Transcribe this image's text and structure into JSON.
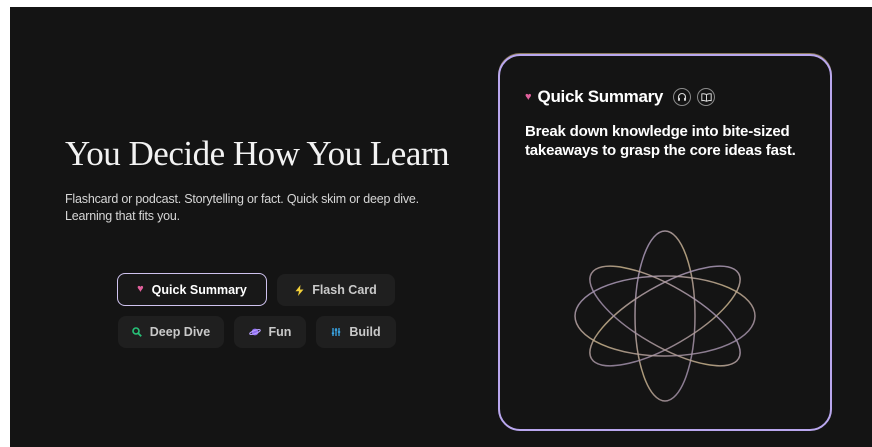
{
  "hero": {
    "title": "You Decide How You Learn",
    "subtitle": "Flashcard or podcast. Storytelling or fact. Quick skim or deep dive. Learning that fits you."
  },
  "modes": [
    {
      "label": "Quick Summary",
      "icon": "heart-icon",
      "color": "#e0609c",
      "active": true
    },
    {
      "label": "Flash Card",
      "icon": "lightning-icon",
      "color": "#f2d03a",
      "active": false
    },
    {
      "label": "Deep Dive",
      "icon": "magnifier-icon",
      "color": "#27c278",
      "active": false
    },
    {
      "label": "Fun",
      "icon": "planet-icon",
      "color": "#8f6cf0",
      "active": false
    },
    {
      "label": "Build",
      "icon": "sliders-icon",
      "color": "#3aa7e8",
      "active": false
    }
  ],
  "card": {
    "title": "Quick Summary",
    "description": "Break down knowledge into bite-sized takeaways to grasp the core ideas fast.",
    "icons": [
      "headphones-icon",
      "book-icon"
    ],
    "border_color": "#b9a7ee"
  },
  "colors": {
    "background": "#141414",
    "chip_background": "#1f1f1f",
    "accent_border": "#cfc3ef"
  }
}
